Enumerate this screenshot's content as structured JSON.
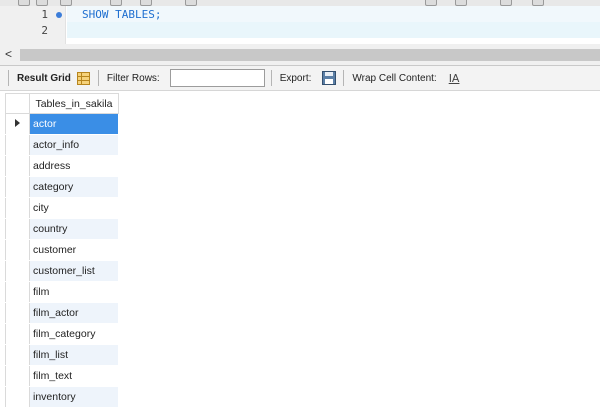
{
  "editor": {
    "lines": [
      {
        "number": "1",
        "code": "SHOW TABLES;"
      },
      {
        "number": "2",
        "code": ""
      }
    ],
    "scroll_left_arrow": "<"
  },
  "result_toolbar": {
    "result_grid_label": "Result Grid",
    "filter_rows_label": "Filter Rows:",
    "filter_rows_value": "",
    "export_label": "Export:",
    "wrap_cell_label": "Wrap Cell Content:",
    "wrap_icon_glyph": "IA",
    "icons": {
      "grid": "grid-table-icon",
      "export": "floppy-disk-icon",
      "wrap": "wrap-text-icon"
    }
  },
  "result_grid": {
    "column_header": "Tables_in_sakila",
    "selected_index": 0,
    "rows": [
      "actor",
      "actor_info",
      "address",
      "category",
      "city",
      "country",
      "customer",
      "customer_list",
      "film",
      "film_actor",
      "film_category",
      "film_list",
      "film_text",
      "inventory"
    ]
  },
  "colors": {
    "selected_row": "#3a8ee6",
    "alt_row": "#eef4fb",
    "sql_keyword": "#1f6fd0"
  }
}
